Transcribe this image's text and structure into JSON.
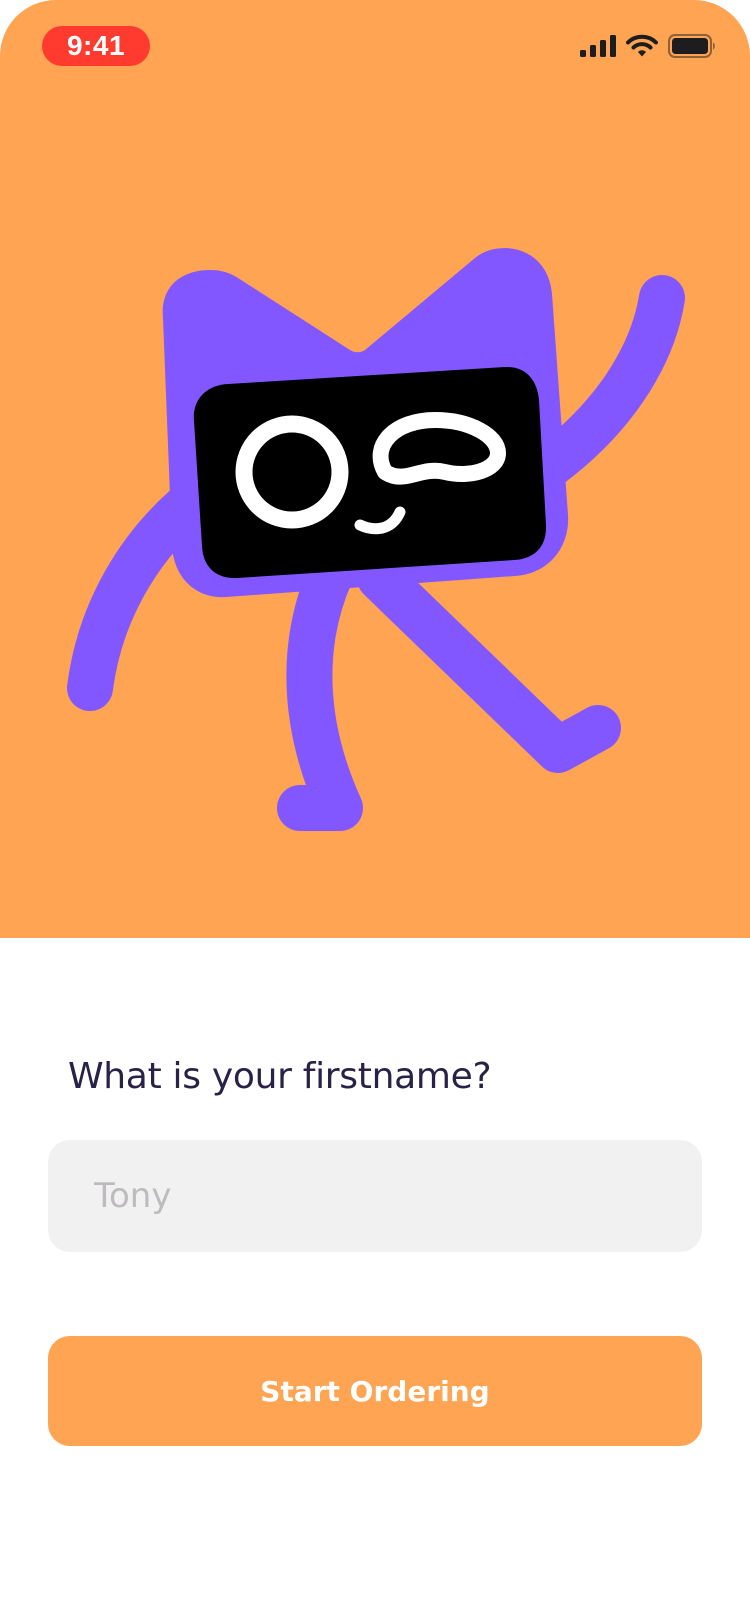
{
  "status_bar": {
    "time": "9:41",
    "icons": [
      "cellular-signal-icon",
      "wifi-icon",
      "battery-icon"
    ]
  },
  "hero": {
    "background_color": "#FEA452",
    "illustration": "waving-mascot-illustration",
    "mascot_color": "#8257FF"
  },
  "form": {
    "question": "What is your firstname?",
    "name_placeholder": "Tony",
    "name_value": "",
    "submit_label": "Start Ordering"
  },
  "colors": {
    "accent": "#FEA452",
    "text_primary": "#2A2147",
    "input_background": "#F2F1F2",
    "placeholder": "#BDBBBE",
    "time_pill": "#FF3B30"
  }
}
